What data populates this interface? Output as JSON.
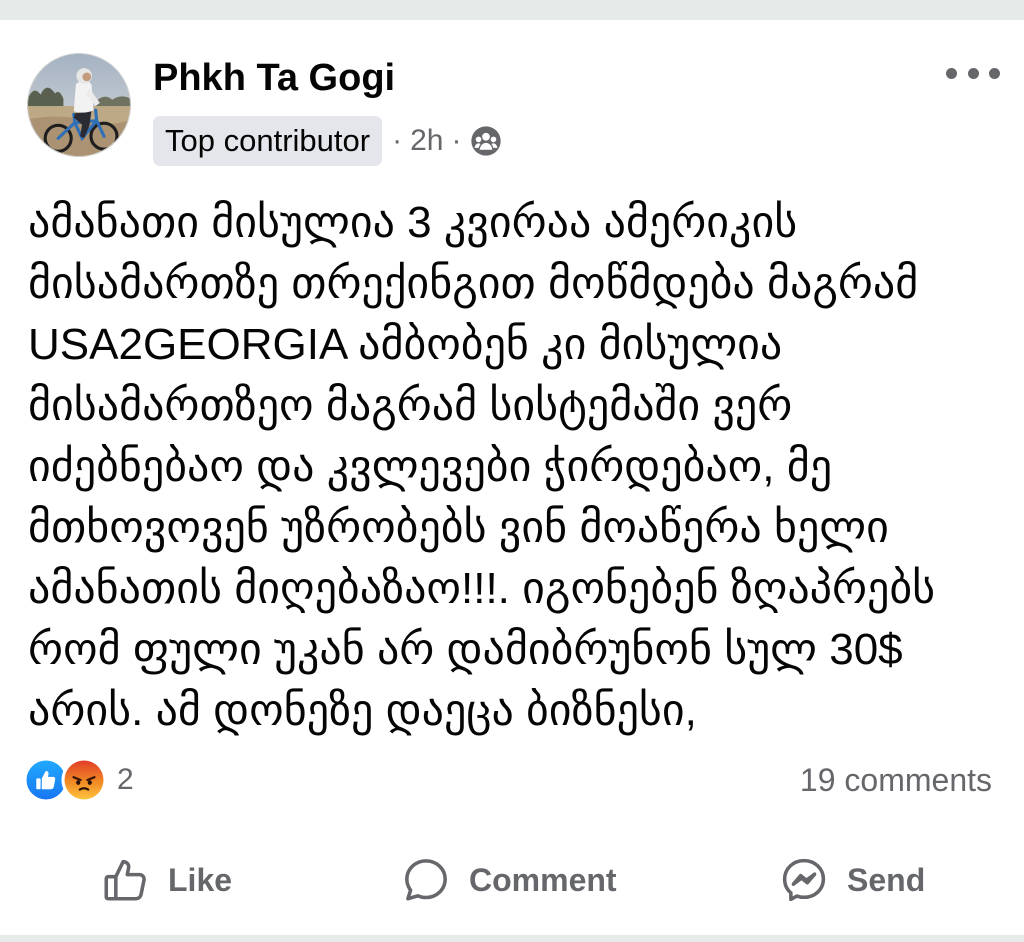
{
  "post": {
    "author": {
      "name": "Phkh Ta Gogi",
      "badge": "Top contributor"
    },
    "meta": {
      "separator": "·",
      "time": "2h"
    },
    "text_lines": [
      "ამანათი მისულია 3 კვირაა ამერიკის",
      "მისამართზე თრექინგით მოწმდება მაგრამ",
      "USA2GEORGIA ამბობენ კი მისულია",
      "მისამართზეო მაგრამ სისტემაში ვერ",
      "იძებნებაო და კვლევები ჭირდებაო, მე",
      "მთხოვოვენ უზრობებს ვინ მოაწერა ხელი",
      "ამანათის მიღებაზაო!!!. იგონებენ ზღაპრებს",
      "რომ ფული უკან არ დამიბრუნონ სულ 30$",
      "არის. ამ დონეზე დაეცა ბიზნესი,"
    ],
    "reactions": {
      "count": "2",
      "comments": "19 comments"
    },
    "actions": {
      "like": "Like",
      "comment": "Comment",
      "send": "Send"
    }
  },
  "icons": {
    "avatar": "profile-photo-cyclist",
    "audience": "friends-icon",
    "more": "more-options-icon",
    "reactions": [
      "like-reaction-icon",
      "angry-reaction-icon"
    ],
    "like_action": "like-icon",
    "comment_action": "comment-icon",
    "send_action": "messenger-send-icon"
  },
  "colors": {
    "text": "#050505",
    "secondary": "#65676B",
    "badge_bg": "#E4E6EB",
    "divider": "#E6EBEA",
    "like_blue": "#1877F2",
    "angry_orange": "#F08A24"
  }
}
